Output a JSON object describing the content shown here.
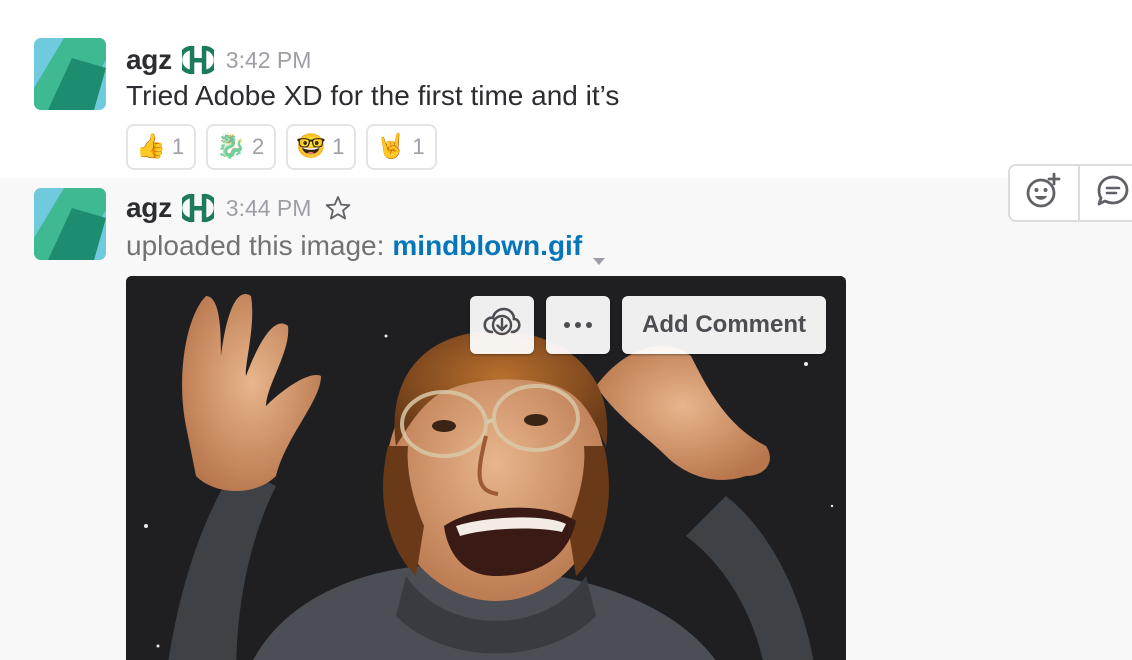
{
  "messages": [
    {
      "author": "agz",
      "status_icon": "h-status-icon",
      "time": "3:42 PM",
      "text": "Tried Adobe XD for the first time and it’s",
      "reactions": [
        {
          "icon": "thumbs-up-icon",
          "glyph": "👍",
          "count": "1"
        },
        {
          "icon": "dragon-icon",
          "glyph": "🐉",
          "count": "2"
        },
        {
          "icon": "nerd-face-icon",
          "glyph": "🤓",
          "count": "1"
        },
        {
          "icon": "rock-on-hand-icon",
          "glyph": "🤘",
          "count": "1"
        }
      ]
    },
    {
      "author": "agz",
      "status_icon": "h-status-icon",
      "time": "3:44 PM",
      "upload_prefix": "uploaded this image:",
      "file_name": "mindblown.gif",
      "image_actions": {
        "comment_label": "Add Comment"
      }
    }
  ],
  "hover_actions": [
    "add-reaction-icon",
    "start-thread-icon"
  ],
  "colors": {
    "link": "#0576b9",
    "status_green": "#1d7a5c",
    "avatar_teal": "#3eb991",
    "avatar_blue": "#6ecadc"
  }
}
